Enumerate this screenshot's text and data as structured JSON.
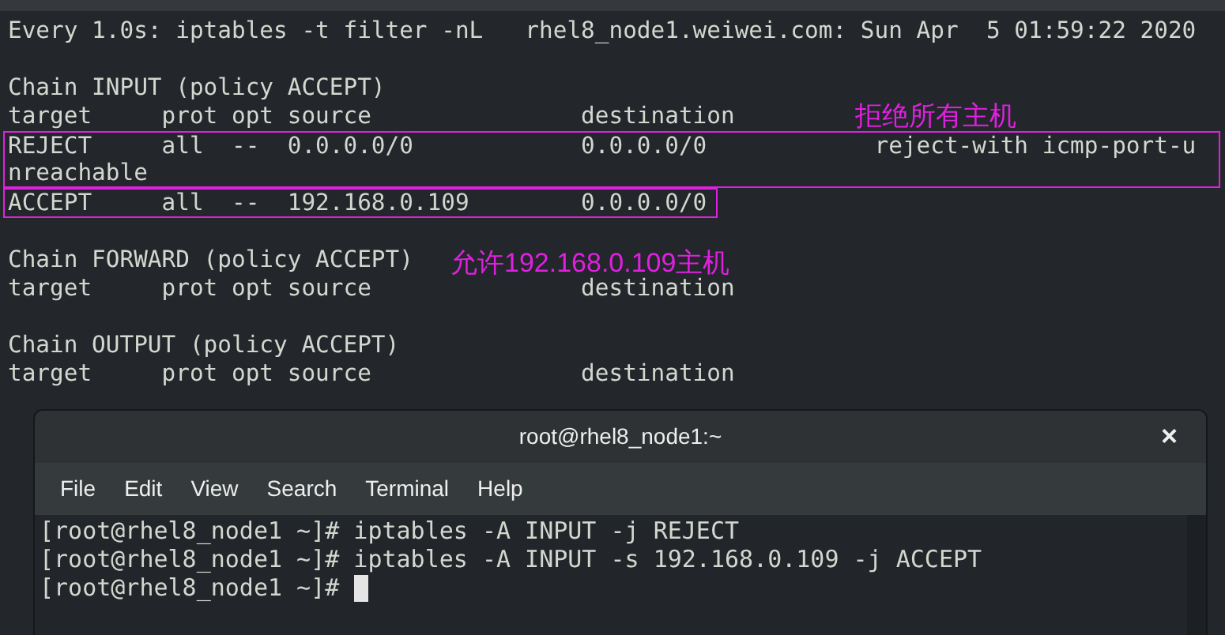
{
  "watch_terminal": {
    "header": "Every 1.0s: iptables -t filter -nL   rhel8_node1.weiwei.com: Sun Apr  5 01:59:22 2020",
    "groups": [
      {
        "kind": "blank"
      },
      {
        "kind": "text",
        "lines": [
          "Chain INPUT (policy ACCEPT)",
          "target     prot opt source               destination"
        ]
      },
      {
        "kind": "boxed",
        "lines": [
          "REJECT     all  --  0.0.0.0/0            0.0.0.0/0            reject-with icmp-port-u",
          "nreachable"
        ]
      },
      {
        "kind": "boxed",
        "lines": [
          "ACCEPT     all  --  192.168.0.109        0.0.0.0/0"
        ]
      },
      {
        "kind": "blank"
      },
      {
        "kind": "text",
        "lines": [
          "Chain FORWARD (policy ACCEPT)",
          "target     prot opt source               destination"
        ]
      },
      {
        "kind": "blank"
      },
      {
        "kind": "text",
        "lines": [
          "Chain OUTPUT (policy ACCEPT)",
          "target     prot opt source               destination"
        ]
      }
    ]
  },
  "annotations": [
    {
      "text": "拒绝所有主机"
    },
    {
      "text": "允许192.168.0.109主机"
    }
  ],
  "window": {
    "title": "root@rhel8_node1:~",
    "close": "×",
    "menu": [
      "File",
      "Edit",
      "View",
      "Search",
      "Terminal",
      "Help"
    ],
    "lines": [
      {
        "text": "[root@rhel8_node1 ~]# iptables -A INPUT -j REJECT",
        "cursor": false
      },
      {
        "text": "[root@rhel8_node1 ~]# iptables -A INPUT -s 192.168.0.109 -j ACCEPT",
        "cursor": false
      },
      {
        "text": "[root@rhel8_node1 ~]# ",
        "cursor": true
      }
    ]
  }
}
